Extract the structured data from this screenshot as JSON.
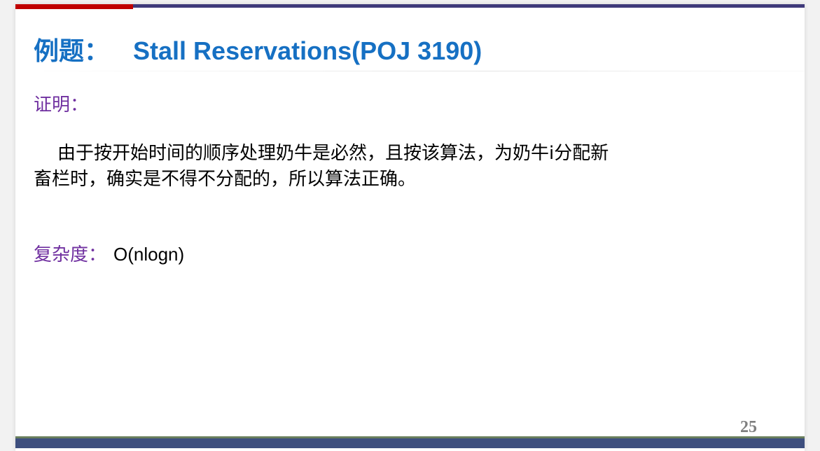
{
  "slide": {
    "title_prefix": "例题：",
    "title_main": "Stall Reservations(POJ 3190)",
    "proof_label": "证明：",
    "proof_line1": "由于按开始时间的顺序处理奶牛是必然，且按该算法，为奶牛i分配新",
    "proof_line2": "畜栏时，确实是不得不分配的，所以算法正确。",
    "complexity_label": "复杂度：",
    "complexity_value": "O(nlogn)",
    "page_number": "25"
  },
  "colors": {
    "title": "#1670c3",
    "label": "#7030a0",
    "top_bar_red": "#c00000",
    "top_bar_purple": "#3f3a7a",
    "bottom_bar": "#3e4f7e"
  }
}
